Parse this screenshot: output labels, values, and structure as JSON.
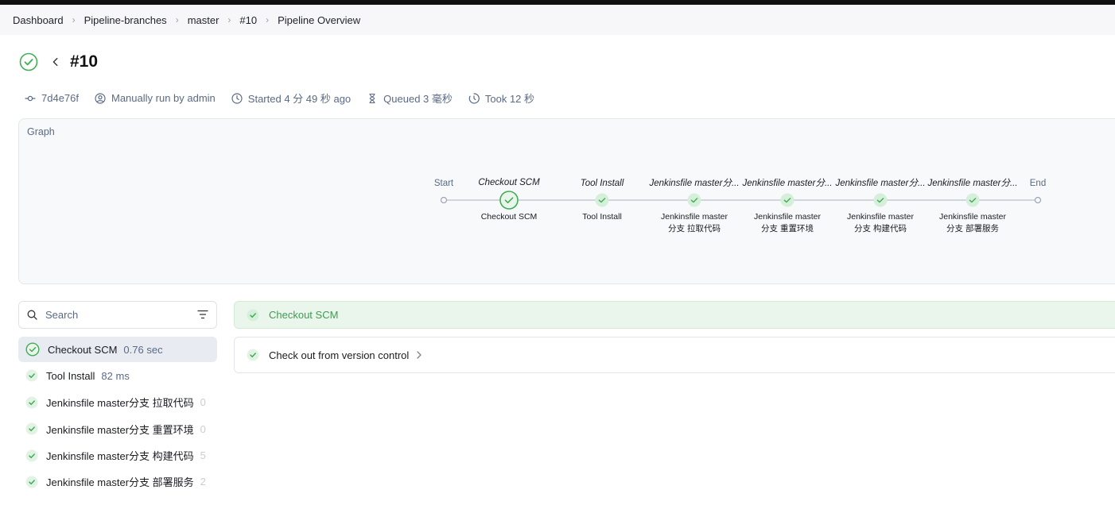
{
  "breadcrumb": [
    "Dashboard",
    "Pipeline-branches",
    "master",
    "#10",
    "Pipeline Overview"
  ],
  "run": {
    "title": "#10",
    "commit": "7d4e76f",
    "trigger": "Manually run by admin",
    "started": "Started 4 分 49 秒 ago",
    "queued": "Queued 3 毫秒",
    "took": "Took 12 秒"
  },
  "graph": {
    "label": "Graph",
    "start": "Start",
    "end": "End",
    "nodes": [
      {
        "top": "Checkout SCM",
        "bottom1": "Checkout SCM",
        "bottom2": ""
      },
      {
        "top": "Tool Install",
        "bottom1": "Tool Install",
        "bottom2": ""
      },
      {
        "top": "Jenkinsfile master分...",
        "bottom1": "Jenkinsfile master",
        "bottom2": "分支 拉取代码"
      },
      {
        "top": "Jenkinsfile master分...",
        "bottom1": "Jenkinsfile master",
        "bottom2": "分支 重置环境"
      },
      {
        "top": "Jenkinsfile master分...",
        "bottom1": "Jenkinsfile master",
        "bottom2": "分支 构建代码"
      },
      {
        "top": "Jenkinsfile master分...",
        "bottom1": "Jenkinsfile master",
        "bottom2": "分支 部署服务"
      }
    ]
  },
  "search": {
    "placeholder": "Search"
  },
  "stages": [
    {
      "name": "Checkout SCM",
      "duration": "0.76 sec",
      "active": true
    },
    {
      "name": "Tool Install",
      "duration": "82 ms",
      "active": false
    },
    {
      "name": "Jenkinsfile master分支 拉取代码",
      "duration": "0",
      "active": false
    },
    {
      "name": "Jenkinsfile master分支 重置环境",
      "duration": "0",
      "active": false
    },
    {
      "name": "Jenkinsfile master分支 构建代码",
      "duration": "5",
      "active": false
    },
    {
      "name": "Jenkinsfile master分支 部署服务",
      "duration": "2",
      "active": false
    }
  ],
  "detail": {
    "header": "Checkout SCM",
    "steps": [
      "Check out from version control"
    ]
  },
  "colors": {
    "success": "#3fae54",
    "success_bg": "#eaf6ec",
    "muted": "#5a6a85"
  }
}
